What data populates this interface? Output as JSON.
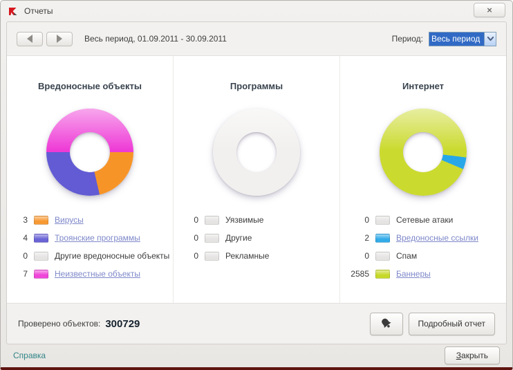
{
  "window": {
    "title": "Отчеты",
    "close_glyph": "×"
  },
  "toolbar": {
    "period_text": "Весь период, 01.09.2011 - 30.09.2011",
    "period_label": "Период:",
    "period_value": "Весь период"
  },
  "summary": {
    "label": "Проверено объектов:",
    "value": "300729",
    "detail_button": "Подробный отчет"
  },
  "footer": {
    "help_link": "Справка",
    "close_accel": "З",
    "close_rest": "акрыть"
  },
  "colors": {
    "orange": "#f79428",
    "violet": "#625bd4",
    "gray": "#e4e3e2",
    "magenta": "#ee3bd6",
    "blue": "#27a7e8",
    "lime": "#c3d71e",
    "selection": "#316ac5",
    "maroon_edge": "#5e1410",
    "link": "#7e88c9",
    "help": "#2f8486"
  },
  "chart_data": [
    {
      "type": "pie",
      "variant": "donut",
      "title": "Вредоносные объекты",
      "categories": [
        "Вирусы",
        "Троянские программы",
        "Другие вредоносные объекты",
        "Неизвестные объекты"
      ],
      "values": [
        3,
        4,
        0,
        7
      ],
      "colors": [
        "#f79428",
        "#625bd4",
        "#e4e3e2",
        "#ee3bd6"
      ],
      "links": [
        true,
        true,
        false,
        true
      ],
      "legend_position": "bottom",
      "render": {
        "from_deg": 270,
        "slices": [
          {
            "color": "#ee3bd6",
            "angle": 180
          },
          {
            "color": "#f79428",
            "angle": 77.1
          },
          {
            "color": "#625bd4",
            "angle": 102.9
          }
        ]
      }
    },
    {
      "type": "pie",
      "variant": "donut",
      "title": "Программы",
      "categories": [
        "Уязвимые",
        "Другие",
        "Рекламные"
      ],
      "values": [
        0,
        0,
        0
      ],
      "colors": [
        "#e4e3e2",
        "#e4e3e2",
        "#e4e3e2"
      ],
      "links": [
        false,
        false,
        false
      ],
      "legend_position": "bottom",
      "render": {
        "from_deg": 0,
        "slices": [
          {
            "color": "#f1f0ee",
            "angle": 360
          }
        ]
      }
    },
    {
      "type": "pie",
      "variant": "donut",
      "title": "Интернет",
      "categories": [
        "Сетевые атаки",
        "Вредоносные ссылки",
        "Спам",
        "Баннеры"
      ],
      "values": [
        0,
        2,
        0,
        2585
      ],
      "colors": [
        "#e4e3e2",
        "#27a7e8",
        "#e4e3e2",
        "#c3d71e"
      ],
      "links": [
        false,
        true,
        false,
        true
      ],
      "legend_position": "bottom",
      "render": {
        "from_deg": 0,
        "slices": [
          {
            "color": "#cbda2f",
            "angle": 97
          },
          {
            "color": "#27a7e8",
            "angle": 16
          },
          {
            "color": "#cbda2f",
            "angle": 247
          }
        ]
      }
    }
  ]
}
